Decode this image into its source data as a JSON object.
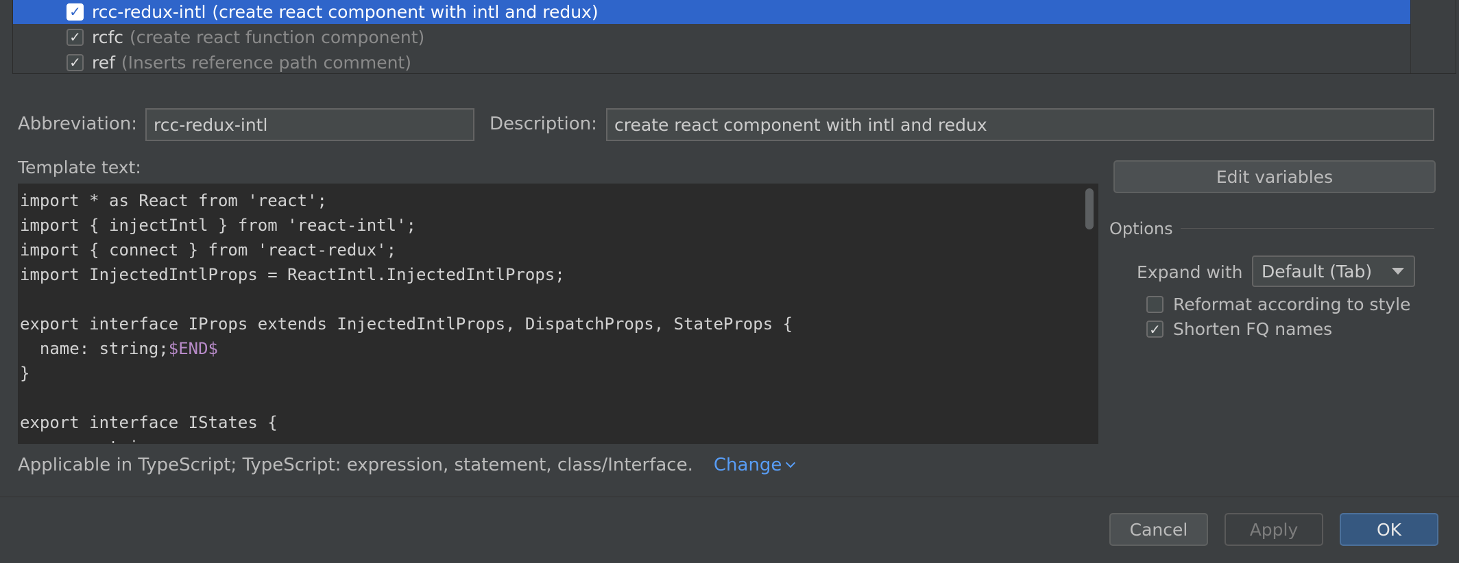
{
  "template_list": {
    "items": [
      {
        "name": "rcc-redux-intl",
        "description": "(create react component with intl and redux)",
        "checked": true,
        "selected": true
      },
      {
        "name": "rcfc",
        "description": "(create react function component)",
        "checked": true,
        "selected": false
      },
      {
        "name": "ref",
        "description": "(Inserts reference path comment)",
        "checked": true,
        "selected": false
      }
    ]
  },
  "form": {
    "abbreviation_label": "Abbreviation:",
    "abbreviation_value": "rcc-redux-intl",
    "description_label": "Description:",
    "description_value": "create react component with intl and redux",
    "template_text_label": "Template text:"
  },
  "template_code": {
    "lines": [
      "import * as React from 'react';",
      "import { injectIntl } from 'react-intl';",
      "import { connect } from 'react-redux';",
      "import InjectedIntlProps = ReactIntl.InjectedIntlProps;",
      "",
      "export interface IProps extends InjectedIntlProps, DispatchProps, StateProps {",
      "  name: string;",
      "}",
      "",
      "export interface IStates {",
      "  name: string;"
    ],
    "end_variable": "$END$"
  },
  "right_panel": {
    "edit_variables_label": "Edit variables",
    "options_heading": "Options",
    "expand_with_label": "Expand with",
    "expand_with_value": "Default (Tab)",
    "reformat_label": "Reformat according to style",
    "reformat_checked": false,
    "shorten_label": "Shorten FQ names",
    "shorten_checked": true
  },
  "applicable": {
    "text": "Applicable in TypeScript; TypeScript: expression, statement, class/Interface.",
    "change_label": "Change"
  },
  "footer": {
    "cancel_label": "Cancel",
    "apply_label": "Apply",
    "ok_label": "OK"
  },
  "icons": {
    "check": "check-icon",
    "chevron": "chevron-down-icon",
    "dropdown": "dropdown-caret-icon"
  },
  "colors": {
    "selection": "#2f65ca",
    "link": "#589df6",
    "template_variable": "#b88bc9",
    "primary_button": "#365880"
  }
}
